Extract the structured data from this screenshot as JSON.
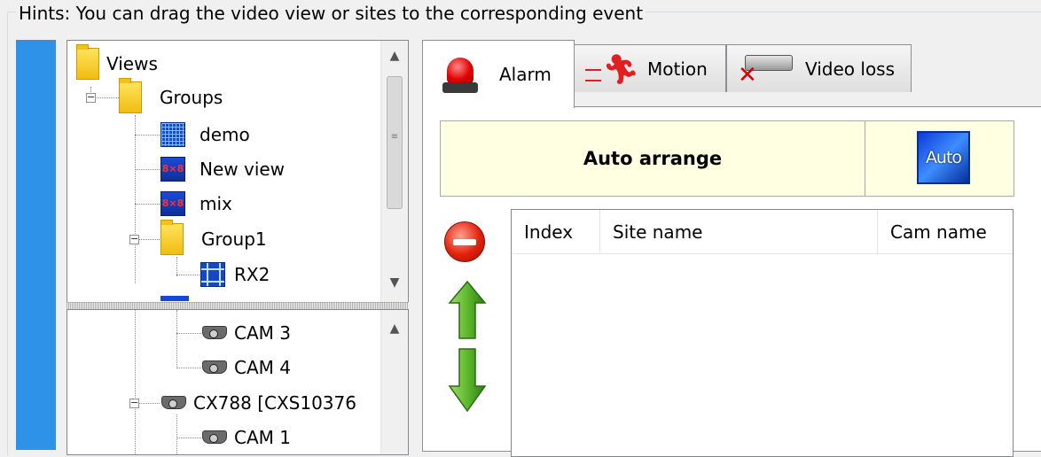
{
  "hint": "Hints: You can drag the video view or sites to the corresponding event",
  "views_tree": {
    "nodes": [
      {
        "label": "Views",
        "icon": "folder-icon"
      },
      {
        "label": "Groups",
        "icon": "folder-icon"
      },
      {
        "label": "demo",
        "icon": "grid-view-icon"
      },
      {
        "label": "New view",
        "icon": "view-8x8-icon"
      },
      {
        "label": "mix",
        "icon": "view-8x8-icon"
      },
      {
        "label": "Group1",
        "icon": "folder-icon"
      },
      {
        "label": "RX2",
        "icon": "quad-view-icon"
      }
    ],
    "view_badge": "8×8"
  },
  "sites_tree": {
    "nodes": [
      {
        "label": "CAM  3",
        "icon": "camera-icon"
      },
      {
        "label": "CAM  4",
        "icon": "camera-icon"
      },
      {
        "label": "CX788 [CXS10376",
        "icon": "camera-icon"
      },
      {
        "label": "CAM  1",
        "icon": "camera-icon"
      }
    ]
  },
  "tabs": [
    {
      "label": "Alarm",
      "icon": "siren-icon",
      "active": true
    },
    {
      "label": "Motion",
      "icon": "running-man-icon",
      "active": false
    },
    {
      "label": "Video loss",
      "icon": "camera-x-icon",
      "active": false
    }
  ],
  "auto_arrange": {
    "label": "Auto arrange",
    "button_label": "Auto"
  },
  "list": {
    "columns": [
      "Index",
      "Site name",
      "Cam name"
    ],
    "rows": []
  },
  "colors": {
    "accent_strip": "#2e93e8",
    "auto_strip_bg": "#ffffe1",
    "auto_button": "#1d5ce8"
  }
}
